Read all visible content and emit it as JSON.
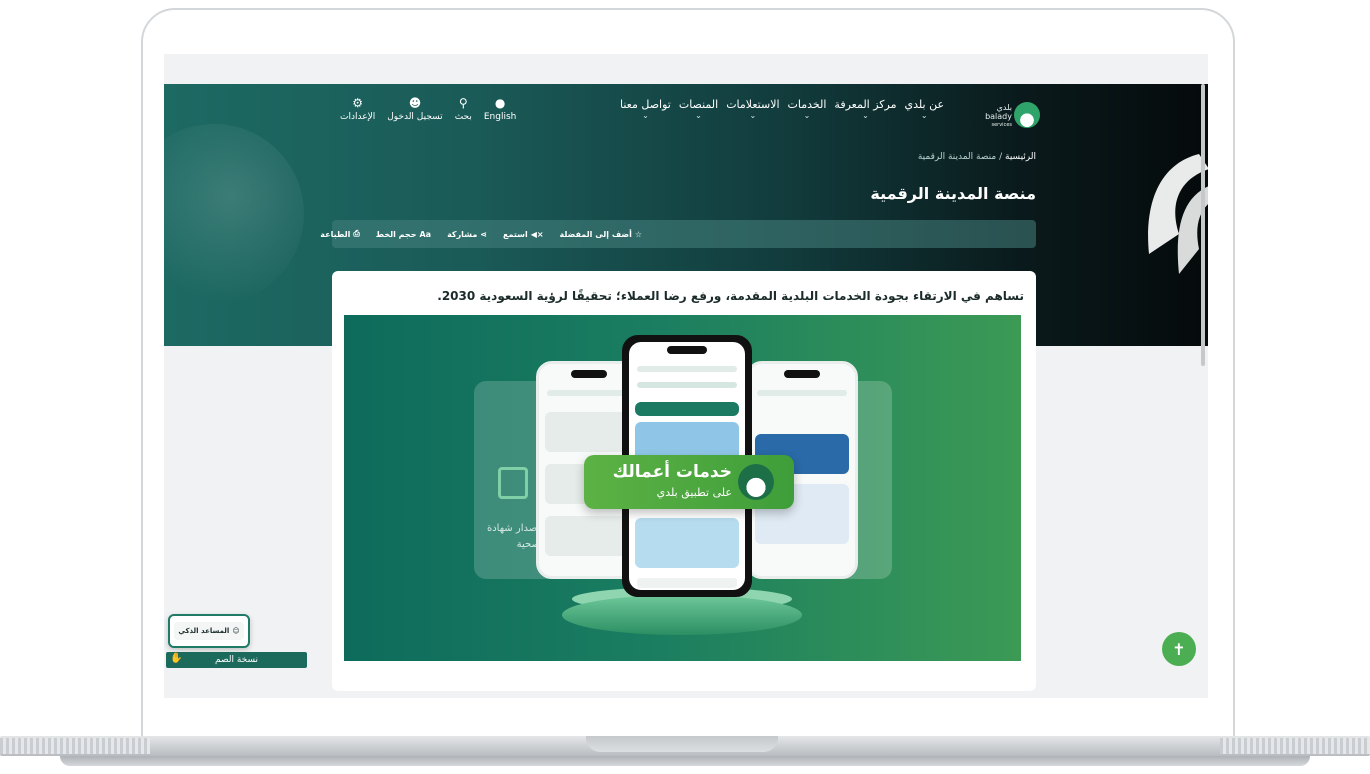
{
  "nav": {
    "logo_text_ar": "بلدي",
    "logo_text_en": "balady",
    "logo_text_services": "services",
    "items": [
      {
        "label": "عن بلدي"
      },
      {
        "label": "مركز المعرفة"
      },
      {
        "label": "الخدمات"
      },
      {
        "label": "الاستعلامات"
      },
      {
        "label": "المنصات"
      },
      {
        "label": "تواصل معنا"
      }
    ],
    "tools": [
      {
        "label": "English",
        "icon": "globe-icon"
      },
      {
        "label": "بحث",
        "icon": "search-icon"
      },
      {
        "label": "تسجيل الدخول",
        "icon": "user-icon"
      },
      {
        "label": "الإعدادات",
        "icon": "gear-icon"
      }
    ]
  },
  "breadcrumb": {
    "home": "الرئيسية",
    "separator": "/",
    "current": "منصة المدينة الرقمية"
  },
  "page": {
    "title": "منصة المدينة الرقمية"
  },
  "toolbar": {
    "favorite": "أضف إلى المفضلة",
    "listen": "استمع",
    "share": "مشاركة",
    "font_size": "حجم الخط",
    "print": "الطباعة"
  },
  "content": {
    "description": "تساهم في الارتقاء بجودة الخدمات البلدية المقدمة، ورفع رضا العملاء؛ تحقيقًا لرؤية السعودية 2030."
  },
  "banner": {
    "title": "خدمات أعمالك",
    "subtitle": "على تطبيق بلدي",
    "left_card_text": "إصدار شهادة صحية"
  },
  "widgets": {
    "assistant": "المساعد الذكي",
    "deaf_version": "نسخة الصم"
  },
  "colors": {
    "brand_green": "#1b6a5c",
    "accent_green": "#4cae52"
  }
}
